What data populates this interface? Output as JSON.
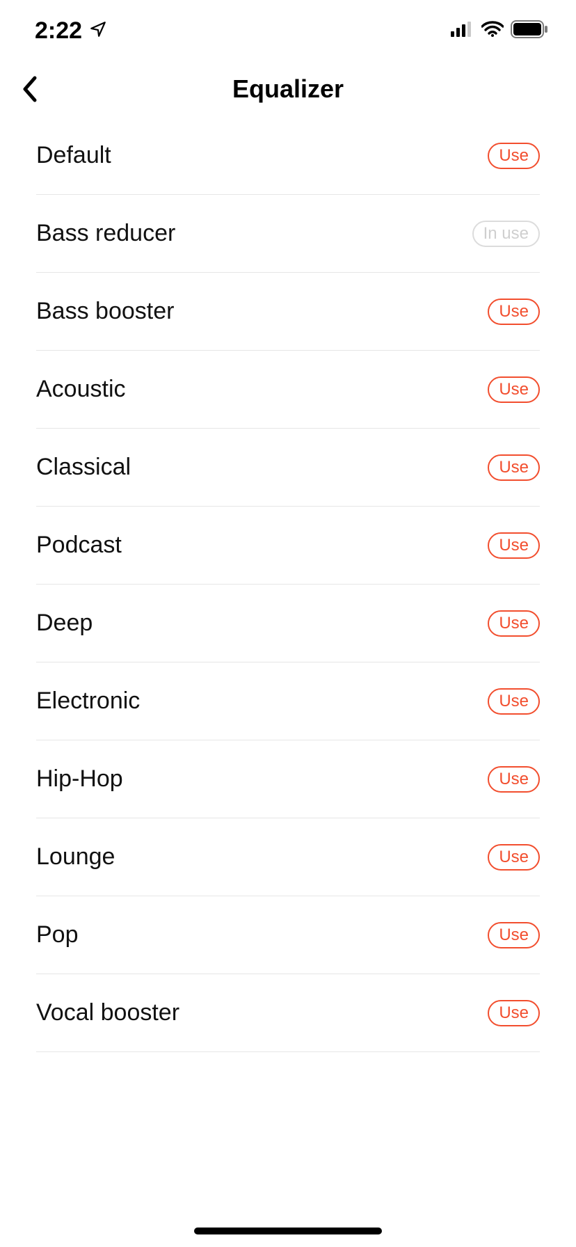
{
  "status": {
    "time": "2:22"
  },
  "header": {
    "title": "Equalizer"
  },
  "button_labels": {
    "use": "Use",
    "in_use": "In use"
  },
  "presets": [
    {
      "label": "Default",
      "in_use": false
    },
    {
      "label": "Bass reducer",
      "in_use": true
    },
    {
      "label": "Bass booster",
      "in_use": false
    },
    {
      "label": "Acoustic",
      "in_use": false
    },
    {
      "label": "Classical",
      "in_use": false
    },
    {
      "label": "Podcast",
      "in_use": false
    },
    {
      "label": "Deep",
      "in_use": false
    },
    {
      "label": "Electronic",
      "in_use": false
    },
    {
      "label": "Hip-Hop",
      "in_use": false
    },
    {
      "label": "Lounge",
      "in_use": false
    },
    {
      "label": "Pop",
      "in_use": false
    },
    {
      "label": "Vocal booster",
      "in_use": false
    }
  ]
}
